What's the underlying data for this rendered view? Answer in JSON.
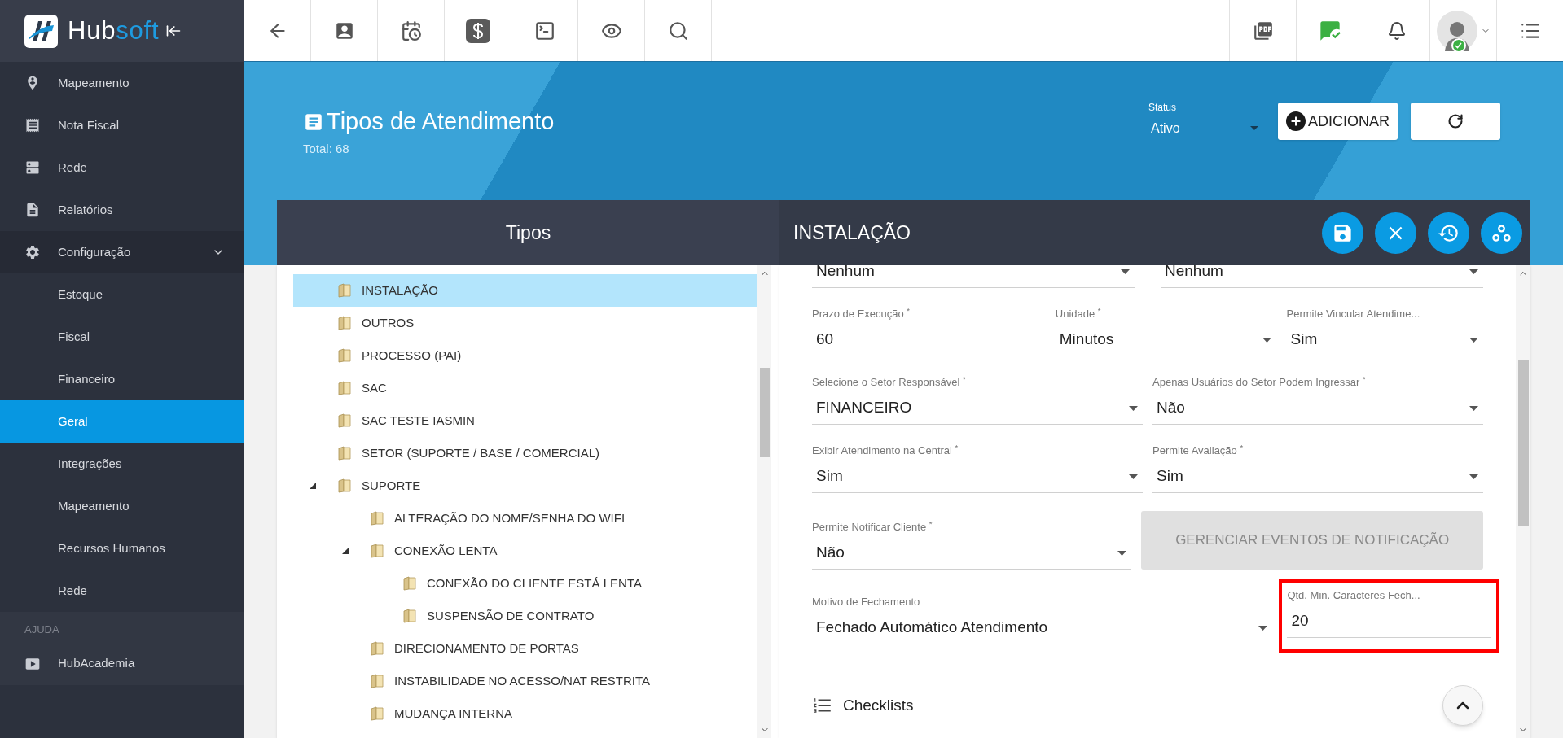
{
  "logo": {
    "parts": [
      "Hub",
      "soft"
    ]
  },
  "sidebar": {
    "items": [
      {
        "label": "Mapeamento",
        "selected": false
      },
      {
        "label": "Nota Fiscal",
        "selected": false
      },
      {
        "label": "Rede",
        "selected": false
      },
      {
        "label": "Relatórios",
        "selected": false
      },
      {
        "label": "Configuração",
        "selected": false,
        "expanded": true,
        "children": [
          {
            "label": "Estoque",
            "selected": false
          },
          {
            "label": "Fiscal",
            "selected": false
          },
          {
            "label": "Financeiro",
            "selected": false
          },
          {
            "label": "Geral",
            "selected": true
          },
          {
            "label": "Integrações",
            "selected": false
          },
          {
            "label": "Mapeamento",
            "selected": false
          },
          {
            "label": "Recursos Humanos",
            "selected": false
          },
          {
            "label": "Rede",
            "selected": false
          }
        ]
      }
    ],
    "section": "AJUDA",
    "section_items": [
      {
        "label": "HubAcademia",
        "selected": false
      }
    ]
  },
  "header": {
    "title": "Tipos de Atendimento",
    "total": "Total: 68",
    "status_label": "Status",
    "status_value": "Ativo",
    "add_button": "ADICIONAR"
  },
  "tree_panel": {
    "title": "Tipos",
    "items": [
      {
        "label": "INSTALAÇÃO",
        "selected": true
      },
      {
        "label": "OUTROS",
        "selected": false
      },
      {
        "label": "PROCESSO (PAI)",
        "selected": false
      },
      {
        "label": "SAC",
        "selected": false
      },
      {
        "label": "SAC TESTE IASMIN",
        "selected": false
      },
      {
        "label": "SETOR (SUPORTE / BASE / COMERCIAL)",
        "selected": false
      },
      {
        "label": "SUPORTE",
        "selected": false,
        "expanded": true,
        "children": [
          {
            "label": "ALTERAÇÃO DO NOME/SENHA DO WIFI",
            "selected": false
          },
          {
            "label": "CONEXÃO LENTA",
            "selected": false,
            "expanded": true,
            "children": [
              {
                "label": "CONEXÃO DO CLIENTE ESTÁ LENTA",
                "selected": false
              },
              {
                "label": "SUSPENSÃO DE CONTRATO",
                "selected": false
              }
            ]
          },
          {
            "label": "DIRECIONAMENTO DE PORTAS",
            "selected": false
          },
          {
            "label": "INSTABILIDADE NO ACESSO/NAT RESTRITA",
            "selected": false
          },
          {
            "label": "MUDANÇA INTERNA",
            "selected": false
          }
        ]
      }
    ]
  },
  "detail_panel": {
    "title": "INSTALAÇÃO",
    "rows": [
      [
        {
          "kind": "select",
          "value": "Nenhum"
        },
        {
          "kind": "select",
          "value": "Nenhum"
        }
      ],
      [
        {
          "kind": "input",
          "label": "Prazo de Execução $^{*}$",
          "value": "60"
        },
        {
          "kind": "select",
          "label": "Unidade $^{*}$",
          "value": "Minutos"
        },
        {
          "kind": "select",
          "label": "Permite Vincular Atendime...",
          "value": "Sim"
        }
      ],
      [
        {
          "kind": "select",
          "label": "Selecione o Setor Responsável $^{*}$",
          "value": "FINANCEIRO"
        },
        {
          "kind": "select",
          "label": "Apenas Usuários do Setor Podem Ingressar $^{*}$",
          "value": "Não"
        }
      ],
      [
        {
          "kind": "select",
          "label": "Exibir Atendimento na Central $^{*}$",
          "value": "Sim"
        },
        {
          "kind": "select",
          "label": "Permite Avaliação $^{*}$",
          "value": "Sim"
        }
      ],
      [
        {
          "kind": "select",
          "label": "Permite Notificar Cliente $^{*}$",
          "value": "Não"
        },
        {
          "kind": "button",
          "label": "GERENCIAR EVENTOS DE NOTIFICAÇÃO",
          "disabled": true
        }
      ],
      [
        {
          "kind": "select",
          "label": "Motivo de Fechamento",
          "value": "Fechado Automático Atendimento"
        },
        {
          "kind": "input",
          "label": "Qtd. Min. Caracteres Fech...",
          "value": "20",
          "highlighted": true
        }
      ]
    ],
    "section": "Checklists"
  }
}
